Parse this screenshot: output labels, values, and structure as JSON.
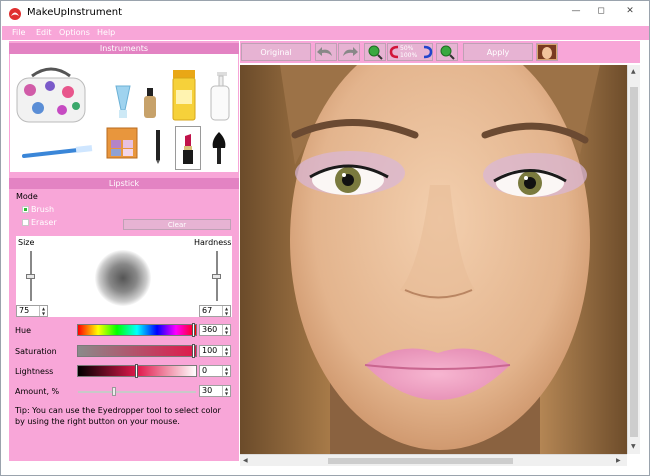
{
  "window": {
    "title": "MakeUpInstrument",
    "controls": {
      "minimize": "—",
      "maximize": "◻",
      "close": "✕"
    }
  },
  "menu": [
    "File",
    "Edit",
    "Options",
    "Help"
  ],
  "instruments": {
    "header": "Instruments",
    "items": [
      "cosmetic-bag",
      "foundation-sponge",
      "foundation-bottle",
      "powder-jar",
      "lotion-pump",
      "toothbrush",
      "eyeshadow-palette",
      "eyeliner-pen",
      "lipstick",
      "blush-brush"
    ],
    "selected": "lipstick"
  },
  "tool_panel": {
    "header": "Lipstick",
    "mode_label": "Mode",
    "modes": [
      {
        "label": "Brush",
        "checked": true
      },
      {
        "label": "Eraser",
        "checked": false
      }
    ],
    "clear_label": "Clear",
    "size_label": "Size",
    "hardness_label": "Hardness",
    "size_value": "75",
    "hardness_value": "67",
    "size_fraction": 0.5,
    "hardness_fraction": 0.5,
    "hue_label": "Hue",
    "hue_value": "360",
    "hue_fraction": 1.0,
    "saturation_label": "Saturation",
    "saturation_value": "100",
    "saturation_fraction": 1.0,
    "lightness_label": "Lightness",
    "lightness_value": "0",
    "lightness_fraction": 0.5,
    "amount_label": "Amount, %",
    "amount_value": "30",
    "amount_fraction": 0.3,
    "tip": "Tip: You can use the Eyedropper tool to select color by using the right button on your mouse."
  },
  "toolbar": {
    "original_label": "Original",
    "apply_label": "Apply",
    "zoom_top": "50%",
    "zoom_bottom": "100%"
  },
  "colors": {
    "panel": "#f8a6d8",
    "header": "#e383c3",
    "button": "#e7b3d3",
    "lip": "#e0184b"
  }
}
